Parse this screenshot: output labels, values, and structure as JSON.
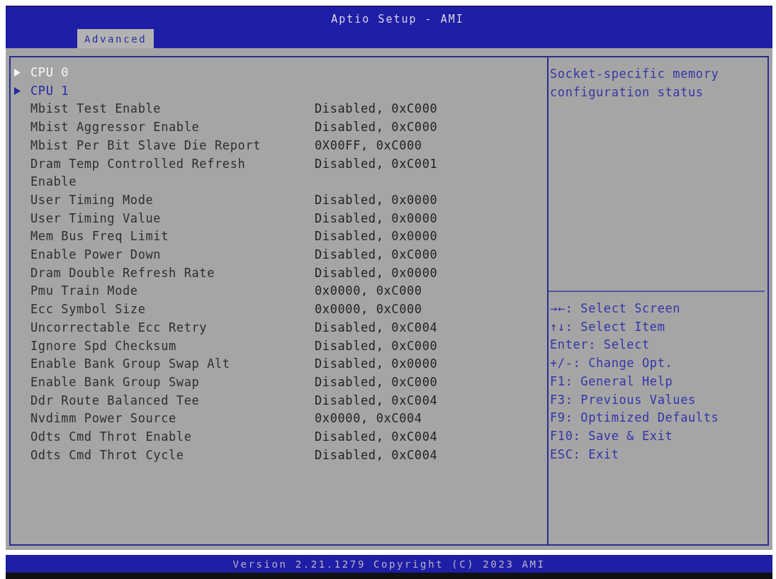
{
  "window": {
    "title": "Aptio Setup - AMI"
  },
  "tabs": [
    {
      "label": "Advanced",
      "selected": true
    }
  ],
  "items": [
    {
      "kind": "submenu",
      "label": "CPU 0",
      "selected": true
    },
    {
      "kind": "submenu",
      "label": "CPU 1",
      "selected": false
    },
    {
      "kind": "setting",
      "label": "Mbist Test Enable",
      "value": "Disabled, 0xC000",
      "selected": false
    },
    {
      "kind": "setting",
      "label": "Mbist Aggressor Enable",
      "value": "Disabled, 0xC000",
      "selected": false
    },
    {
      "kind": "setting",
      "label": "Mbist Per Bit Slave Die Report",
      "value": "0X00FF, 0xC000",
      "selected": false
    },
    {
      "kind": "setting",
      "label": "Dram Temp Controlled Refresh Enable",
      "value": "Disabled, 0xC001",
      "selected": false
    },
    {
      "kind": "setting",
      "label": "User Timing Mode",
      "value": "Disabled, 0x0000",
      "selected": false
    },
    {
      "kind": "setting",
      "label": "User Timing Value",
      "value": "Disabled, 0x0000",
      "selected": false
    },
    {
      "kind": "setting",
      "label": "Mem Bus Freq Limit",
      "value": "Disabled, 0x0000",
      "selected": false
    },
    {
      "kind": "setting",
      "label": "Enable Power Down",
      "value": "Disabled, 0xC000",
      "selected": false
    },
    {
      "kind": "setting",
      "label": "Dram Double Refresh Rate",
      "value": "Disabled, 0x0000",
      "selected": false
    },
    {
      "kind": "setting",
      "label": "Pmu Train Mode",
      "value": "0x0000, 0xC000",
      "selected": false
    },
    {
      "kind": "setting",
      "label": "Ecc Symbol Size",
      "value": "0x0000, 0xC000",
      "selected": false
    },
    {
      "kind": "setting",
      "label": "Uncorrectable Ecc Retry",
      "value": "Disabled, 0xC004",
      "selected": false
    },
    {
      "kind": "setting",
      "label": "Ignore Spd Checksum",
      "value": "Disabled, 0xC000",
      "selected": false
    },
    {
      "kind": "setting",
      "label": "Enable Bank Group Swap Alt",
      "value": "Disabled, 0x0000",
      "selected": false
    },
    {
      "kind": "setting",
      "label": "Enable Bank Group Swap",
      "value": "Disabled, 0xC000",
      "selected": false
    },
    {
      "kind": "setting",
      "label": "Ddr Route Balanced Tee",
      "value": "Disabled, 0xC004",
      "selected": false
    },
    {
      "kind": "setting",
      "label": "Nvdimm Power Source",
      "value": "0x0000, 0xC004",
      "selected": false
    },
    {
      "kind": "setting",
      "label": "Odts Cmd Throt Enable",
      "value": "Disabled, 0xC004",
      "selected": false
    },
    {
      "kind": "setting",
      "label": "Odts Cmd Throt Cycle",
      "value": "Disabled, 0xC004",
      "selected": false
    }
  ],
  "help": {
    "text": "Socket-specific memory configuration status"
  },
  "key_help": [
    "→←: Select Screen",
    "↑↓: Select Item",
    "Enter: Select",
    "+/-: Change Opt.",
    "F1: General Help",
    "F3: Previous Values",
    "F9: Optimized Defaults",
    "F10: Save & Exit",
    "ESC: Exit"
  ],
  "status_bar": {
    "text": "Version 2.21.1279 Copyright (C) 2023 AMI"
  }
}
